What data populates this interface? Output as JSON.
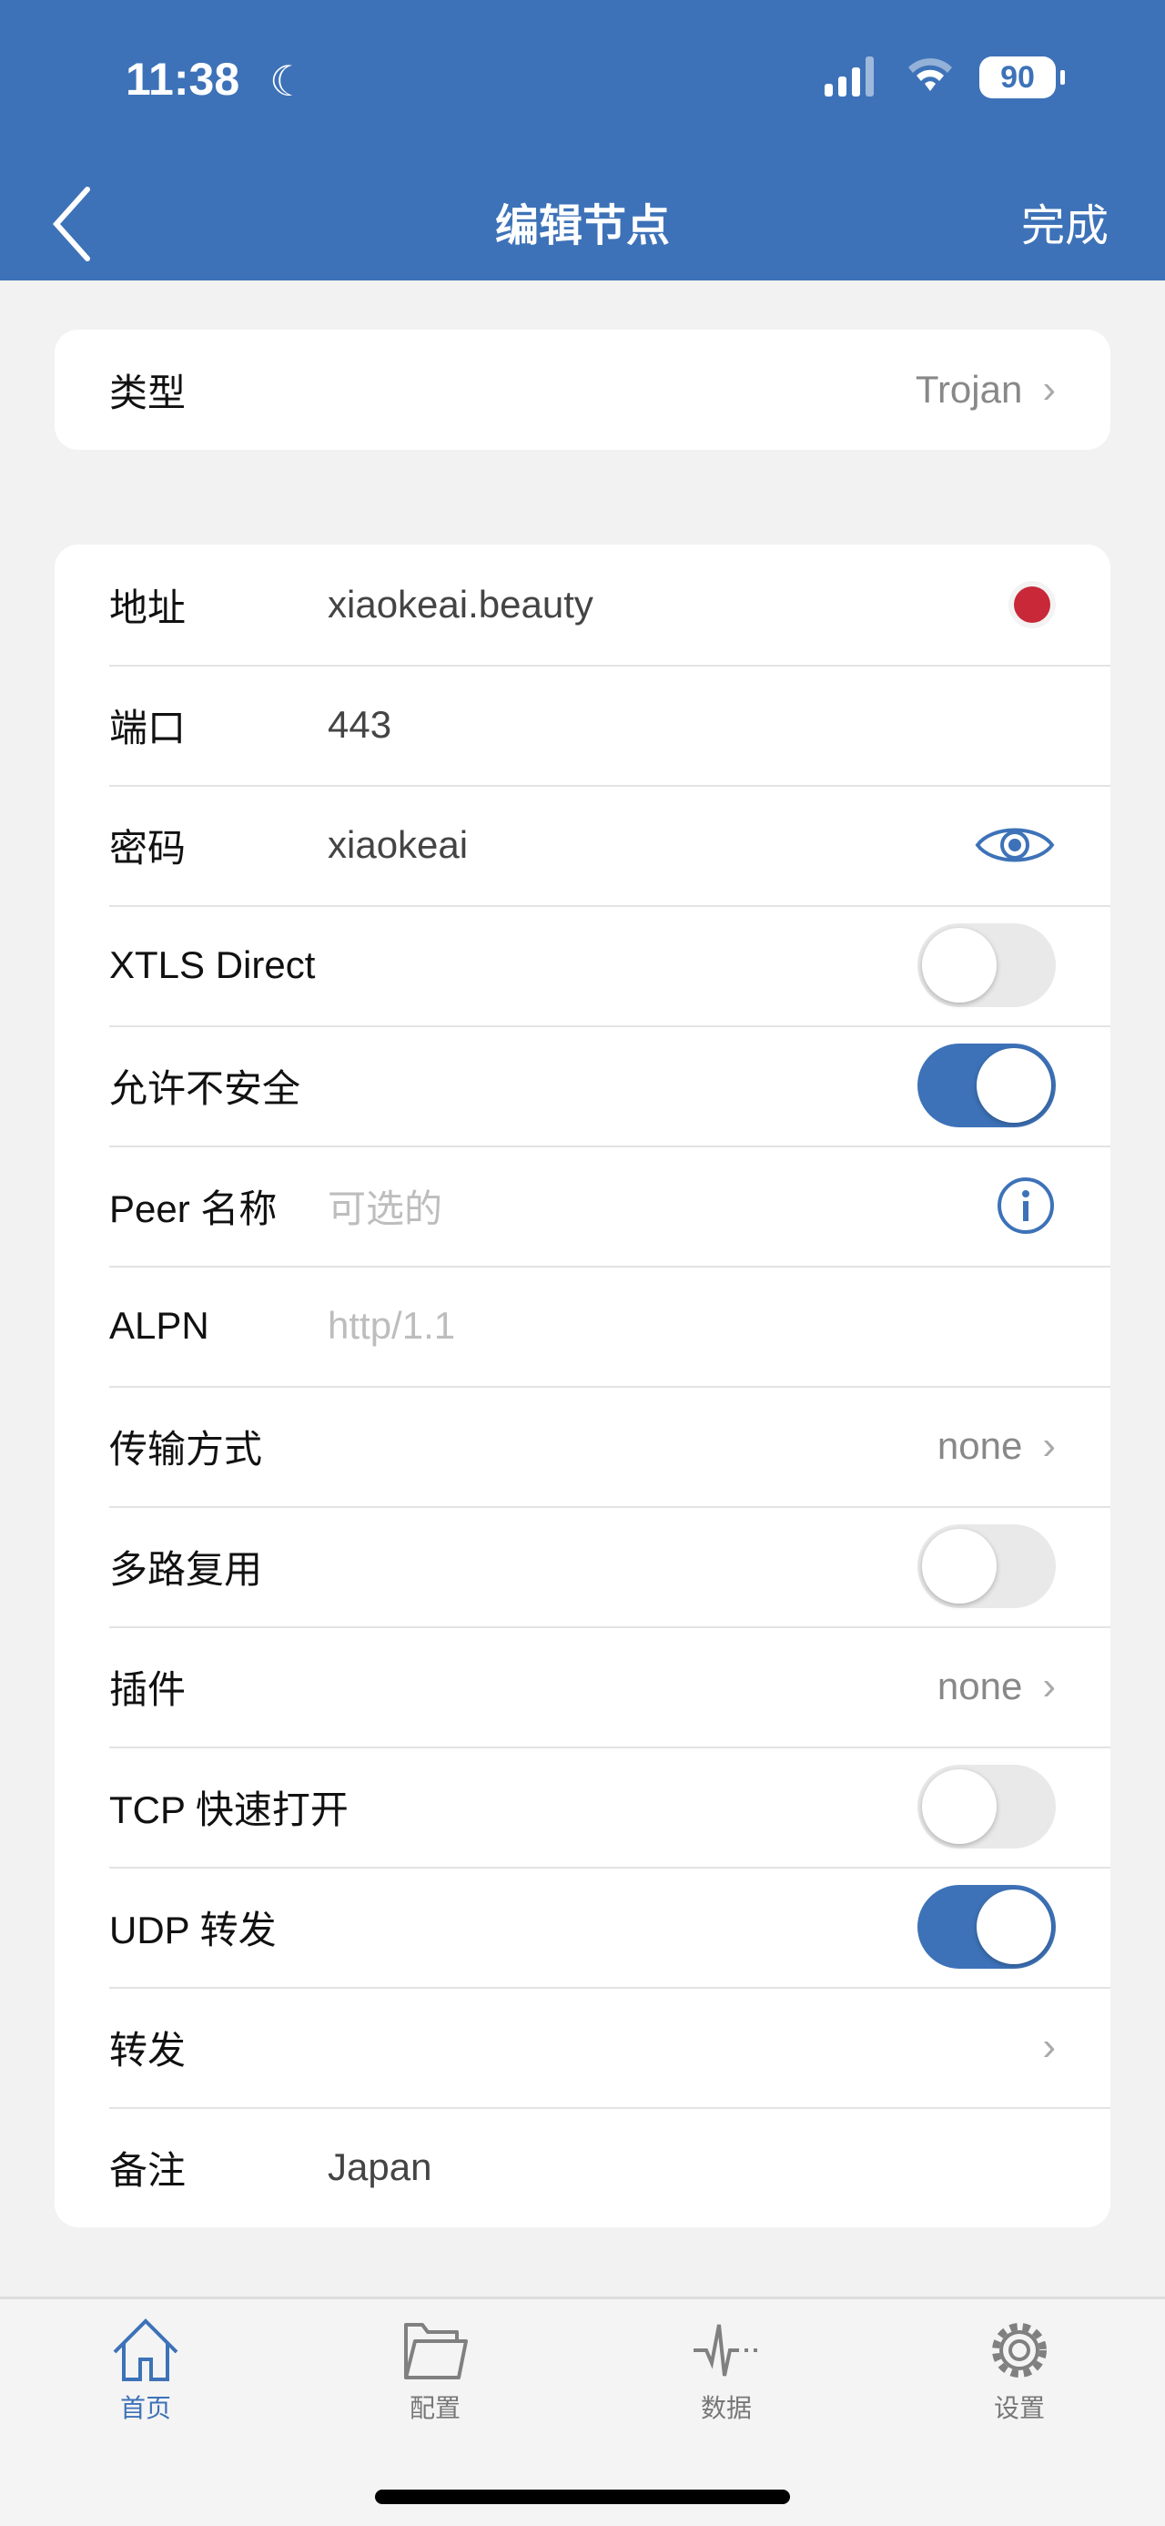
{
  "status_bar": {
    "time": "11:38",
    "battery": "90"
  },
  "nav": {
    "title": "编辑节点",
    "done_label": "完成"
  },
  "type_row": {
    "label": "类型",
    "value": "Trojan"
  },
  "fields": {
    "address": {
      "label": "地址",
      "value": "xiaokeai.beauty"
    },
    "port": {
      "label": "端口",
      "value": "443"
    },
    "password": {
      "label": "密码",
      "value": "xiaokeai"
    },
    "xtls": {
      "label": "XTLS Direct",
      "on": false
    },
    "insecure": {
      "label": "允许不安全",
      "on": true
    },
    "peer": {
      "label": "Peer 名称",
      "placeholder": "可选的"
    },
    "alpn": {
      "label": "ALPN",
      "placeholder": "http/1.1"
    },
    "transport": {
      "label": "传输方式",
      "value": "none"
    },
    "mux": {
      "label": "多路复用",
      "on": false
    },
    "plugin": {
      "label": "插件",
      "value": "none"
    },
    "tfo": {
      "label": "TCP 快速打开",
      "on": false
    },
    "udp": {
      "label": "UDP 转发",
      "on": true
    },
    "forward": {
      "label": "转发"
    },
    "remark": {
      "label": "备注",
      "value": "Japan"
    }
  },
  "tabs": [
    {
      "label": "首页"
    },
    {
      "label": "配置"
    },
    {
      "label": "数据"
    },
    {
      "label": "设置"
    }
  ],
  "colors": {
    "accent": "#3d72b8",
    "status_dot": "#c82838"
  }
}
